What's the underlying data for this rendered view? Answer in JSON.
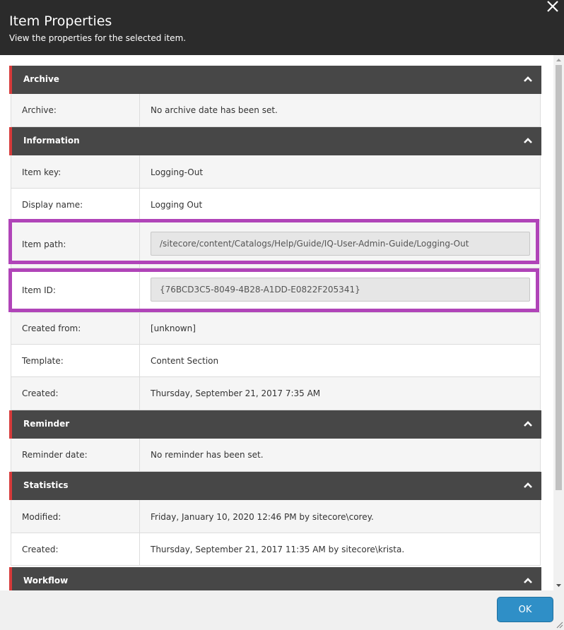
{
  "dialog": {
    "title": "Item Properties",
    "subtitle": "View the properties for the selected item.",
    "close_icon": "close-icon"
  },
  "sections": {
    "archive": {
      "title": "Archive",
      "rows": [
        {
          "label": "Archive:",
          "value": "No archive date has been set."
        }
      ]
    },
    "information": {
      "title": "Information",
      "rows": [
        {
          "label": "Item key:",
          "value": "Logging-Out"
        },
        {
          "label": "Display name:",
          "value": "Logging Out"
        },
        {
          "label": "Item path:",
          "value": "/sitecore/content/Catalogs/Help/Guide/IQ-User-Admin-Guide/Logging-Out"
        },
        {
          "label": "Item ID:",
          "value": "{76BCD3C5-8049-4B28-A1DD-E0822F205341}"
        },
        {
          "label": "Created from:",
          "value": "[unknown]"
        },
        {
          "label": "Template:",
          "value": "Content Section"
        },
        {
          "label": "Created:",
          "value": "Thursday, September 21, 2017 7:35 AM"
        }
      ]
    },
    "reminder": {
      "title": "Reminder",
      "rows": [
        {
          "label": "Reminder date:",
          "value": "No reminder has been set."
        }
      ]
    },
    "statistics": {
      "title": "Statistics",
      "rows": [
        {
          "label": "Modified:",
          "value": "Friday, January 10, 2020 12:46 PM by sitecore\\corey."
        },
        {
          "label": "Created:",
          "value": "Thursday, September 21, 2017 11:35 AM by sitecore\\krista."
        }
      ]
    },
    "workflow": {
      "title": "Workflow"
    }
  },
  "footer": {
    "ok_label": "OK"
  },
  "colors": {
    "header_bg": "#2b2b2b",
    "section_bg": "#474747",
    "section_accent": "#d63b3b",
    "highlight": "#b044b8",
    "ok_button": "#2f8fc7"
  }
}
